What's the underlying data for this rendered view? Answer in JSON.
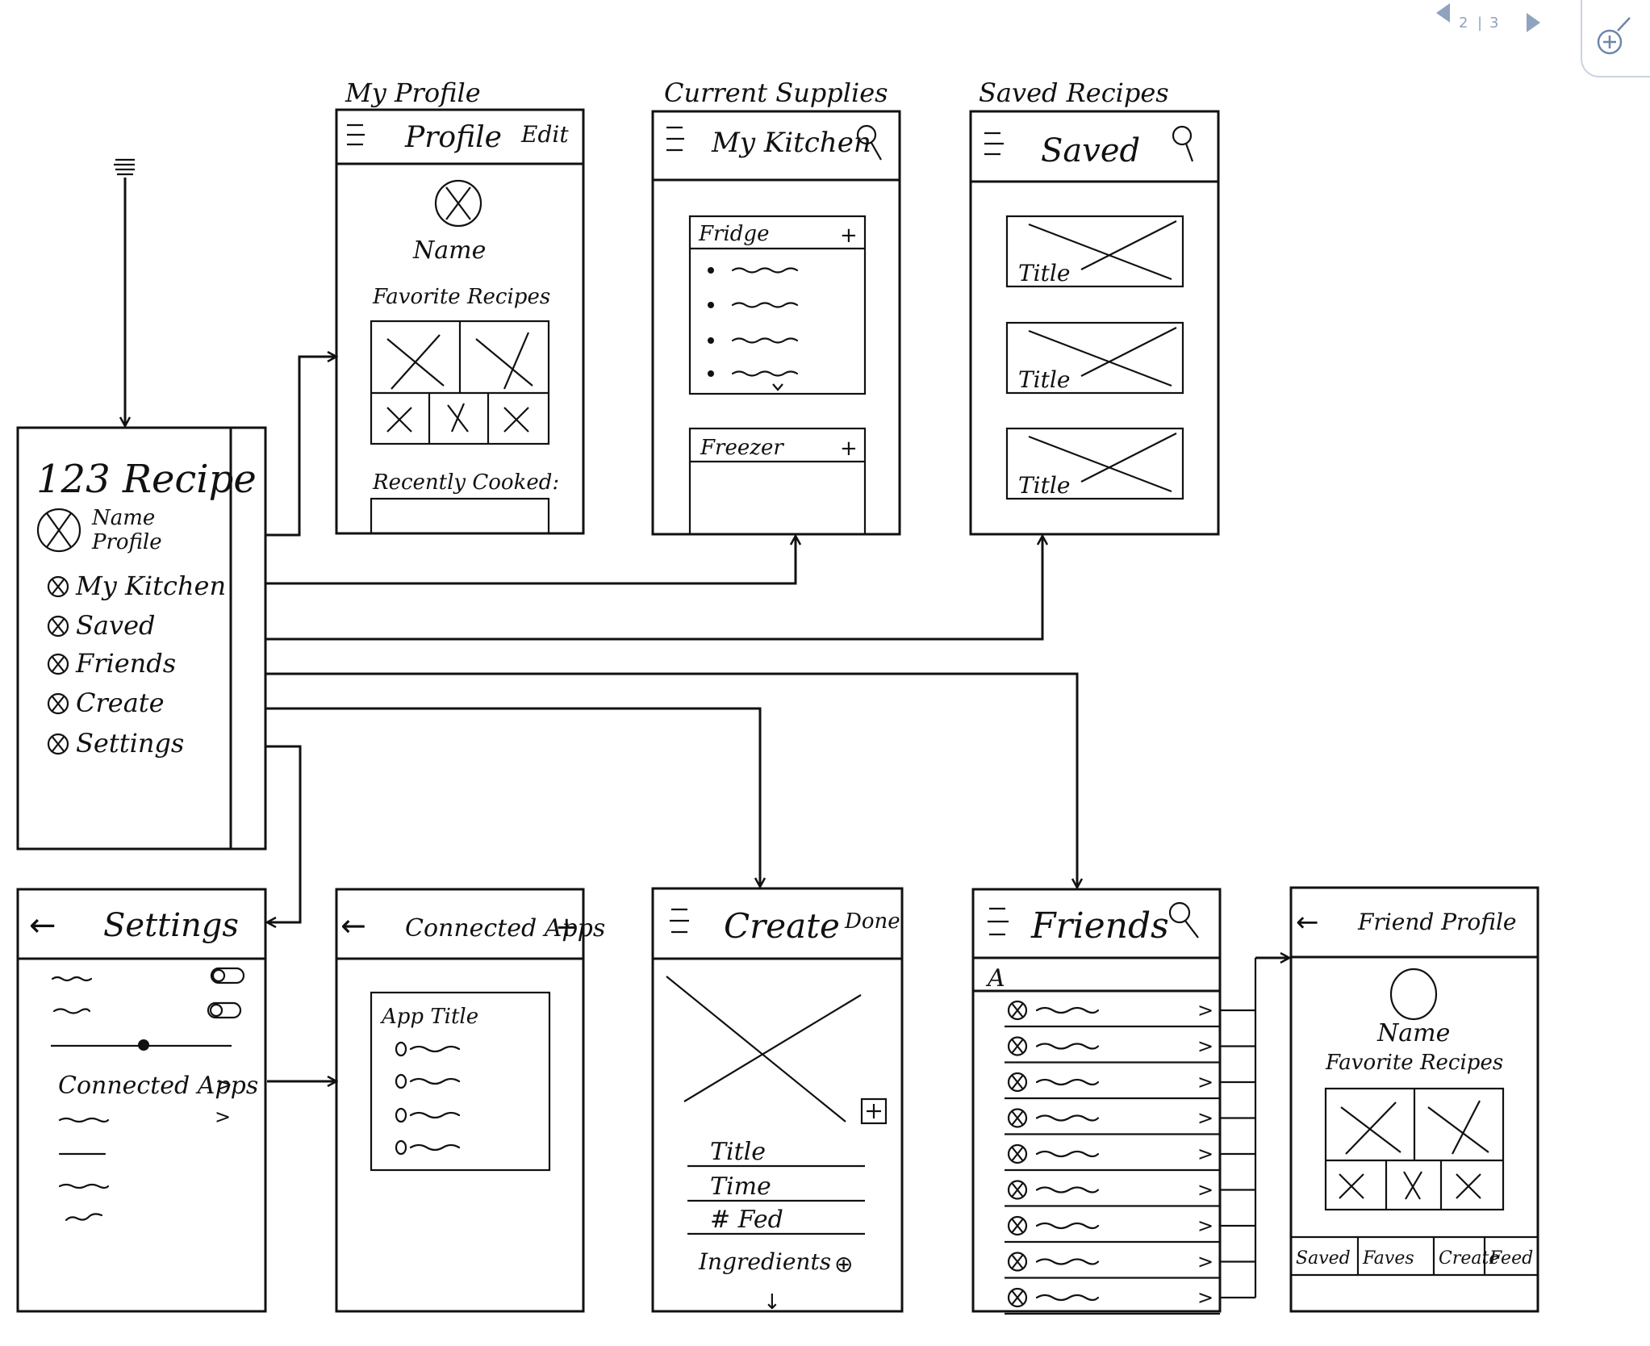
{
  "pager": {
    "current": "2",
    "separator": "|",
    "total": "3"
  },
  "flow_labels": {
    "my_profile": "My Profile",
    "current_supplies": "Current Supplies",
    "saved_recipes": "Saved Recipes"
  },
  "screens": {
    "menu": {
      "app_name": "123 Recipe",
      "profile_line1": "Name",
      "profile_line2": "Profile",
      "items": [
        "My Kitchen",
        "Saved",
        "Friends",
        "Create",
        "Settings"
      ]
    },
    "profile": {
      "title": "Profile",
      "edit": "Edit",
      "name": "Name",
      "favorites": "Favorite Recipes",
      "recently": "Recently Cooked:"
    },
    "kitchen": {
      "title": "My Kitchen",
      "fridge": "Fridge",
      "freezer": "Freezer",
      "plus": "+"
    },
    "saved": {
      "title": "Saved",
      "cards": [
        "Title",
        "Title",
        "Title"
      ]
    },
    "settings": {
      "title": "Settings",
      "back": "←",
      "connected_apps": "Connected Apps",
      "chevron": ">"
    },
    "connected": {
      "title": "Connected Apps",
      "back": "←",
      "plus": "+",
      "app_title": "App Title"
    },
    "create": {
      "title": "Create",
      "done": "Done",
      "fields": [
        "Title",
        "Time",
        "# Fed"
      ],
      "ingredients": "Ingredients",
      "plus": "⊕",
      "down": "↓"
    },
    "friends": {
      "title": "Friends",
      "section": "A",
      "row_count_chevron": ">",
      "rows": 9
    },
    "friend_profile": {
      "title": "Friend Profile",
      "back": "←",
      "name": "Name",
      "favorites": "Favorite Recipes",
      "tabs": [
        "Saved",
        "Faves",
        "Create",
        "Feed"
      ]
    }
  }
}
